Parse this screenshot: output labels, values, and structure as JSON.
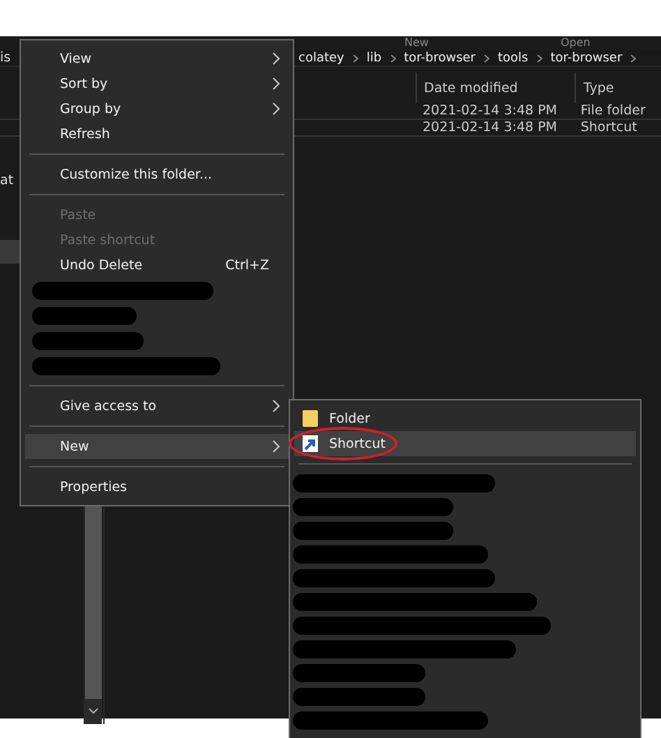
{
  "ribbon": [
    "New",
    "Open"
  ],
  "address": {
    "left_fragment": "is",
    "crumbs": [
      "colatey",
      "lib",
      "tor-browser",
      "tools",
      "tor-browser"
    ]
  },
  "columns": [
    "Date modified",
    "Type"
  ],
  "rows": [
    {
      "date": "2021-02-14 3:48 PM",
      "type": "File folder"
    },
    {
      "date": "2021-02-14 3:48 PM",
      "type": "Shortcut"
    }
  ],
  "nav": {
    "fragment": "at"
  },
  "context_menu": [
    {
      "kind": "item",
      "label": "View",
      "submenu": true,
      "disabled": false,
      "highlighted": false
    },
    {
      "kind": "item",
      "label": "Sort by",
      "submenu": true,
      "disabled": false,
      "highlighted": false
    },
    {
      "kind": "item",
      "label": "Group by",
      "submenu": true,
      "disabled": false,
      "highlighted": false
    },
    {
      "kind": "item",
      "label": "Refresh",
      "submenu": false,
      "disabled": false,
      "highlighted": false
    },
    {
      "kind": "separator"
    },
    {
      "kind": "item",
      "label": "Customize this folder...",
      "submenu": false,
      "disabled": false,
      "highlighted": false
    },
    {
      "kind": "separator"
    },
    {
      "kind": "item",
      "label": "Paste",
      "submenu": false,
      "disabled": true,
      "highlighted": false
    },
    {
      "kind": "item",
      "label": "Paste shortcut",
      "submenu": false,
      "disabled": true,
      "highlighted": false
    },
    {
      "kind": "item",
      "label": "Undo Delete",
      "shortcut": "Ctrl+Z",
      "submenu": false,
      "disabled": false,
      "highlighted": false
    },
    {
      "kind": "redacted"
    },
    {
      "kind": "redacted"
    },
    {
      "kind": "redacted"
    },
    {
      "kind": "redacted"
    },
    {
      "kind": "separator"
    },
    {
      "kind": "item",
      "label": "Give access to",
      "submenu": true,
      "disabled": false,
      "highlighted": false
    },
    {
      "kind": "separator"
    },
    {
      "kind": "item",
      "label": "New",
      "submenu": true,
      "disabled": false,
      "highlighted": true
    },
    {
      "kind": "separator"
    },
    {
      "kind": "item",
      "label": "Properties",
      "submenu": false,
      "disabled": false,
      "highlighted": false
    }
  ],
  "new_submenu": [
    {
      "kind": "folder",
      "label": "Folder",
      "highlighted": false,
      "circled": false
    },
    {
      "kind": "shortcut",
      "label": "Shortcut",
      "highlighted": true,
      "circled": true
    },
    {
      "kind": "separator"
    },
    {
      "kind": "redacted"
    },
    {
      "kind": "redacted"
    },
    {
      "kind": "redacted"
    },
    {
      "kind": "redacted"
    },
    {
      "kind": "redacted"
    },
    {
      "kind": "redacted"
    },
    {
      "kind": "redacted"
    },
    {
      "kind": "redacted"
    },
    {
      "kind": "redacted"
    },
    {
      "kind": "redacted"
    },
    {
      "kind": "redacted"
    }
  ]
}
